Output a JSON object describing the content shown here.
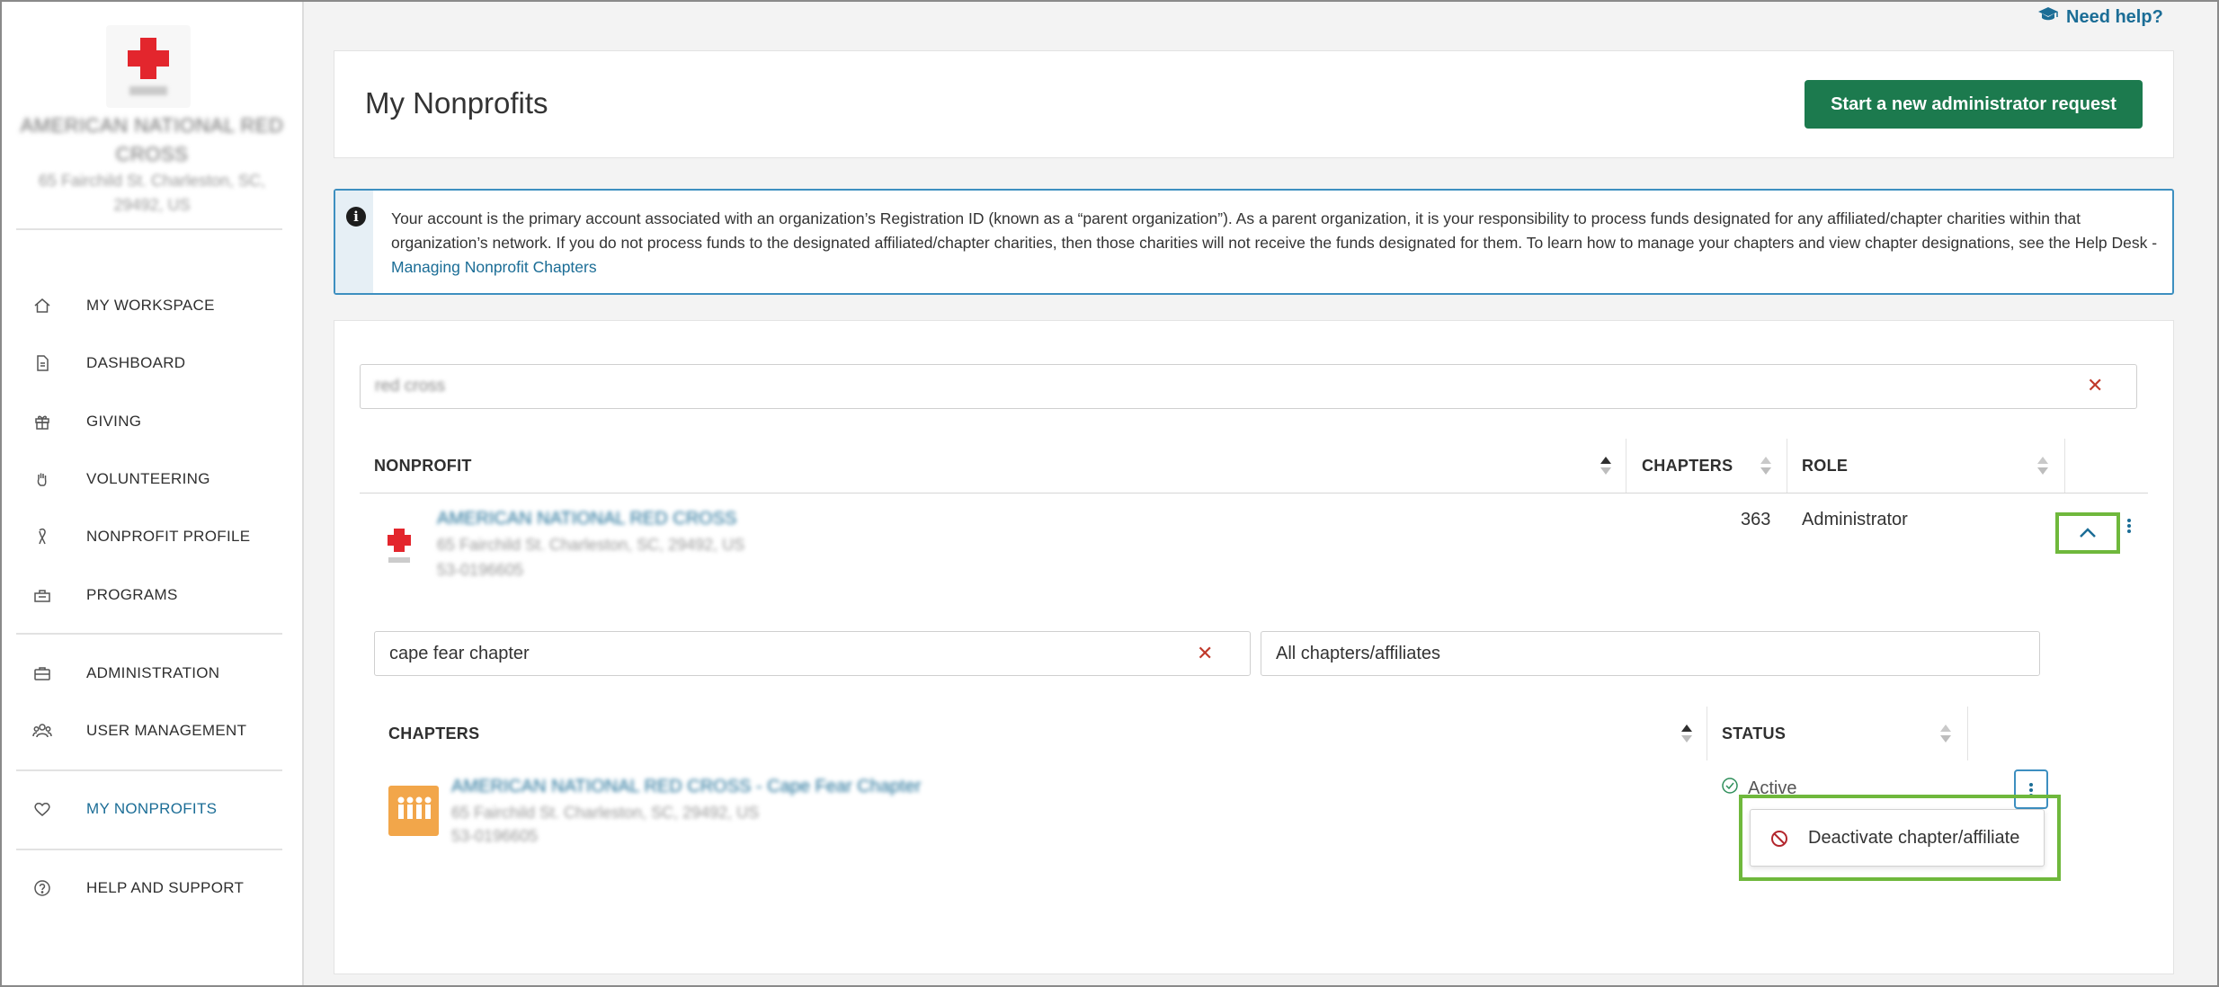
{
  "sidebar": {
    "org": {
      "name": "AMERICAN NATIONAL RED CROSS",
      "address": "65 Fairchild St. Charleston, SC, 29492, US"
    },
    "items": [
      {
        "label": "MY WORKSPACE",
        "icon": "home-icon"
      },
      {
        "label": "DASHBOARD",
        "icon": "document-icon"
      },
      {
        "label": "GIVING",
        "icon": "gift-icon"
      },
      {
        "label": "VOLUNTEERING",
        "icon": "hand-icon"
      },
      {
        "label": "NONPROFIT PROFILE",
        "icon": "ribbon-icon"
      },
      {
        "label": "PROGRAMS",
        "icon": "programs-icon"
      },
      {
        "label": "ADMINISTRATION",
        "icon": "briefcase-icon"
      },
      {
        "label": "USER MANAGEMENT",
        "icon": "users-icon"
      },
      {
        "label": "MY NONPROFITS",
        "icon": "heart-icon",
        "active": true
      },
      {
        "label": "HELP AND SUPPORT",
        "icon": "question-icon"
      }
    ]
  },
  "header": {
    "help_label": "Need help?",
    "title": "My Nonprofits",
    "new_request_label": "Start a new administrator request"
  },
  "info": {
    "text": "Your account is the primary account associated with an organization’s Registration ID (known as a “parent organization”). As a parent organization, it is your responsibility to process funds designated for any affiliated/chapter charities within that organization’s network. If you do not process funds to the designated affiliated/chapter charities, then those charities will not receive the funds designated for them. To learn how to manage your chapters and view chapter designations, see the Help Desk - ",
    "link": "Managing Nonprofit Chapters"
  },
  "search": {
    "value": "red cross"
  },
  "nonprofits_table": {
    "headers": {
      "nonprofit": "NONPROFIT",
      "chapters": "CHAPTERS",
      "role": "ROLE"
    },
    "rows": [
      {
        "name": "AMERICAN NATIONAL RED CROSS",
        "address": "65 Fairchild St. Charleston, SC, 29492, US",
        "ein": "53-0196605",
        "chapters": "363",
        "role": "Administrator"
      }
    ]
  },
  "chapter_filter": {
    "search_value": "cape fear chapter",
    "select_value": "All chapters/affiliates"
  },
  "chapters_table": {
    "headers": {
      "chapters": "CHAPTERS",
      "status": "STATUS"
    },
    "rows": [
      {
        "name": "AMERICAN NATIONAL RED CROSS - Cape Fear Chapter",
        "address": "65 Fairchild St. Charleston, SC, 29492, US",
        "ein": "53-0196605",
        "status": "Active"
      }
    ]
  },
  "row_menu": {
    "items": [
      {
        "label": "Deactivate chapter/affiliate",
        "icon": "ban-icon"
      }
    ]
  },
  "colors": {
    "accent": "#1b6d96",
    "primary_button": "#1c7a4e",
    "highlight": "#6fb83c",
    "danger": "#c0392b"
  }
}
